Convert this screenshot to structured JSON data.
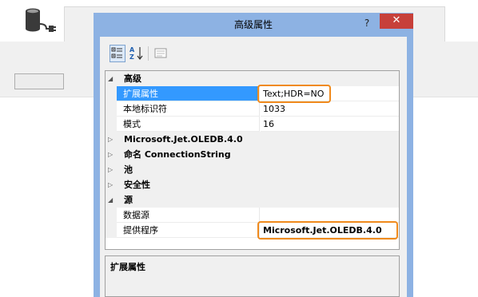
{
  "dialog": {
    "title": "高级属性",
    "help_label": "?",
    "close_label": "✕"
  },
  "toolbar": {
    "buttons": [
      {
        "name": "categorized",
        "icon": "categorized-icon"
      },
      {
        "name": "alphabetical",
        "icon": "sort-az-icon"
      },
      {
        "name": "property-pages",
        "icon": "property-pages-icon"
      }
    ]
  },
  "grid": {
    "categories": [
      {
        "label": "高级",
        "expanded": true,
        "properties": [
          {
            "name": "扩展属性",
            "value": "Text;HDR=NO",
            "selected": true
          },
          {
            "name": "本地标识符",
            "value": "1033"
          },
          {
            "name": "模式",
            "value": "16"
          }
        ]
      },
      {
        "label": "Microsoft.Jet.OLEDB.4.0",
        "expanded": false
      },
      {
        "label": "命名 ConnectionString",
        "expanded": false
      },
      {
        "label": "池",
        "expanded": false
      },
      {
        "label": "安全性",
        "expanded": false
      },
      {
        "label": "源",
        "expanded": true,
        "properties": [
          {
            "name": "数据源",
            "value": ""
          },
          {
            "name": "提供程序",
            "value": "Microsoft.Jet.OLEDB.4.0"
          }
        ]
      }
    ],
    "collapsed_glyph": "▷",
    "expanded_glyph": "◢"
  },
  "description": {
    "title": "扩展属性"
  },
  "colors": {
    "dialog_frame": "#8db2e3",
    "close_button": "#c7403a",
    "selection": "#3399ff",
    "callout": "#f08a1c"
  }
}
